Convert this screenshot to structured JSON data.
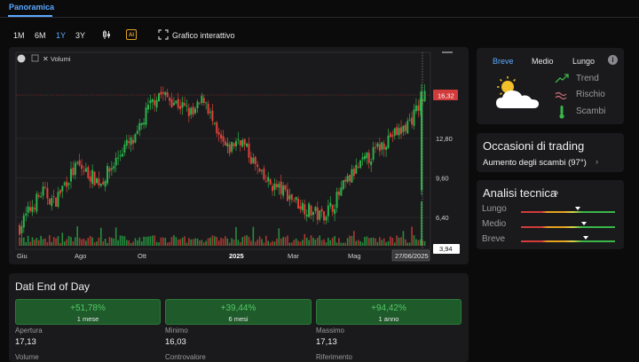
{
  "nav": {
    "active_tab": "Panoramica"
  },
  "toolbar": {
    "ranges": [
      "1M",
      "6M",
      "1Y",
      "3Y"
    ],
    "active_range": "1Y",
    "ai_label": "AI",
    "interactive_label": "Grafico interattivo"
  },
  "chart": {
    "volume_label": "Volumi",
    "current_price": "16,32",
    "volume_value": "3,94",
    "date_badge": "27/06/2025",
    "y_ticks": [
      "12,80",
      "9,60",
      "6,40"
    ],
    "x_labels": [
      "Giu",
      "Ago",
      "Ott",
      "2025",
      "Mar",
      "Mag"
    ],
    "colors": {
      "up": "#2bb34a",
      "down": "#e0413a",
      "last": "#d23b3b",
      "accent": "#5aa9ff"
    }
  },
  "chart_data": {
    "type": "candlestick",
    "title": "",
    "x_labels": [
      "Giu",
      "Ago",
      "Ott",
      "2025",
      "Mar",
      "Mag"
    ],
    "y_ticks": [
      12.8,
      9.6,
      6.4
    ],
    "last_price": 16.32,
    "last_volume": 3.94,
    "last_date": "27/06/2025",
    "closes_approx": [
      5.6,
      7.2,
      8.5,
      7.6,
      9.3,
      10.6,
      9.9,
      9.2,
      10.5,
      12.1,
      12.6,
      15.0,
      16.5,
      16.0,
      15.4,
      14.7,
      16.2,
      13.0,
      11.8,
      12.9,
      11.2,
      9.5,
      8.9,
      8.4,
      7.6,
      7.0,
      6.5,
      7.3,
      8.9,
      10.2,
      11.1,
      12.0,
      13.0,
      13.4,
      14.6,
      16.3
    ]
  },
  "sentiment": {
    "tabs": [
      "Breve",
      "Medio",
      "Lungo"
    ],
    "active_tab": "Breve",
    "rows": [
      "Trend",
      "Rischio",
      "Scambi"
    ]
  },
  "trading": {
    "title": "Occasioni di trading",
    "item": "Aumento degli scambi (97°)"
  },
  "technical": {
    "title": "Analisi tecnica",
    "rows": [
      {
        "label": "Lungo",
        "level": 0.6
      },
      {
        "label": "Medio",
        "level": 0.67
      },
      {
        "label": "Breve",
        "level": 0.69
      }
    ]
  },
  "eod": {
    "title": "Dati End of Day",
    "performance": [
      {
        "value": "+51,78%",
        "label": "1 mese"
      },
      {
        "value": "+39,44%",
        "label": "6 mesi"
      },
      {
        "value": "+94,42%",
        "label": "1 anno"
      }
    ],
    "stats": [
      {
        "label": "Apertura",
        "value": "17,13"
      },
      {
        "label": "Minimo",
        "value": "16,03"
      },
      {
        "label": "Massimo",
        "value": "17,13"
      }
    ],
    "stats_row2_labels": [
      "Volume",
      "Controvalore",
      "Riferimento"
    ]
  }
}
